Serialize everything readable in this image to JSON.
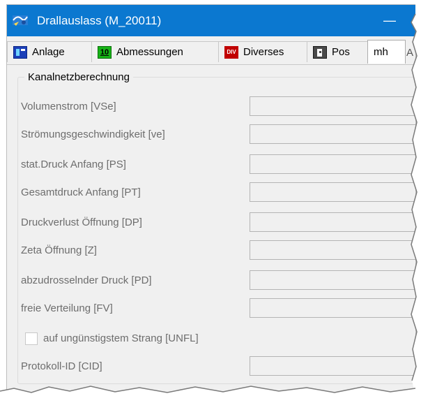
{
  "window": {
    "title": "Drallauslass (M_20011)",
    "minimize_glyph": "—"
  },
  "tabs": [
    {
      "label": "Anlage",
      "icon": "anlage-icon"
    },
    {
      "label": "Abmessungen",
      "icon": "abmessungen-icon",
      "icon_text": "10"
    },
    {
      "label": "Diverses",
      "icon": "diverses-icon",
      "icon_text": "DIV"
    },
    {
      "label": "Pos",
      "icon": "pos-icon"
    },
    {
      "label": "mh",
      "active": true
    },
    {
      "label": "A"
    }
  ],
  "group": {
    "title": "Kanalnetzberechnung"
  },
  "rows": [
    {
      "label": "Volumenstrom [VSe]",
      "value": ""
    },
    {
      "label": "Strömungsgeschwindigkeit [ve]",
      "value": ""
    },
    {
      "label": "stat.Druck Anfang [PS]",
      "value": ""
    },
    {
      "label": "Gesamtdruck Anfang [PT]",
      "value": ""
    },
    {
      "label": "Druckverlust Öffnung [DP]",
      "value": ""
    },
    {
      "label": "Zeta Öffnung [Z]",
      "value": ""
    },
    {
      "label": "abzudrosselnder Druck [PD]",
      "value": ""
    },
    {
      "label": "freie Verteilung [FV]",
      "value": ""
    }
  ],
  "checkbox": {
    "label": "auf ungünstigstem Strang [UNFL]",
    "checked": false
  },
  "protokoll": {
    "label": "Protokoll-ID [CID]",
    "value": ""
  },
  "colors": {
    "titlebar": "#0b78d0",
    "background": "#f0f0f0",
    "disabled_text": "#6d6d6d"
  }
}
